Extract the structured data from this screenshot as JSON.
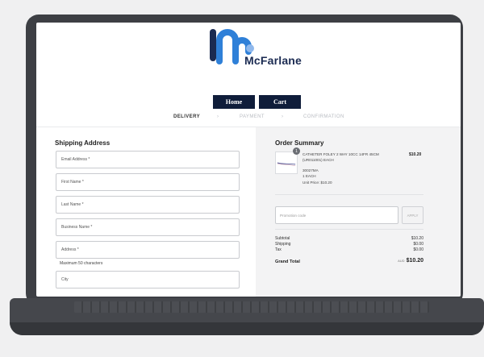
{
  "brand": {
    "name": "McFarlane",
    "colors": {
      "navy": "#1b2b52",
      "blue": "#2f80d8",
      "button": "#0f1d3a"
    }
  },
  "nav": {
    "home_label": "Home",
    "cart_label": "Cart"
  },
  "steps": {
    "delivery": "DELIVERY",
    "payment": "PAYMENT",
    "confirmation": "CONFIRMATION",
    "separator": "›"
  },
  "shipping": {
    "title": "Shipping Address",
    "fields": {
      "email": "Email Address *",
      "first_name": "First Name *",
      "last_name": "Last Name *",
      "business_name": "Business Name *",
      "address": "Address *",
      "city": "City"
    },
    "address_hint": "Maximum 50 characters"
  },
  "summary": {
    "title": "Order Summary",
    "item": {
      "quantity_badge": "1",
      "name_line1": "CATHETER FOLEY 2 WAY 10CC 14FR 45CM",
      "name_line2": "(UR011001) EACH",
      "code": "30027MA",
      "unit": "1 EACH",
      "unit_price": "Unit Price: $10.20",
      "price": "$10.20"
    },
    "promo": {
      "placeholder": "Promotion code",
      "apply_label": "APPLY"
    },
    "totals": {
      "subtotal_label": "Subtotal",
      "subtotal": "$10.20",
      "shipping_label": "Shipping",
      "shipping": "$0.00",
      "tax_label": "Tax",
      "tax": "$0.00",
      "grand_label": "Grand Total",
      "currency": "AUD",
      "grand": "$10.20"
    }
  }
}
